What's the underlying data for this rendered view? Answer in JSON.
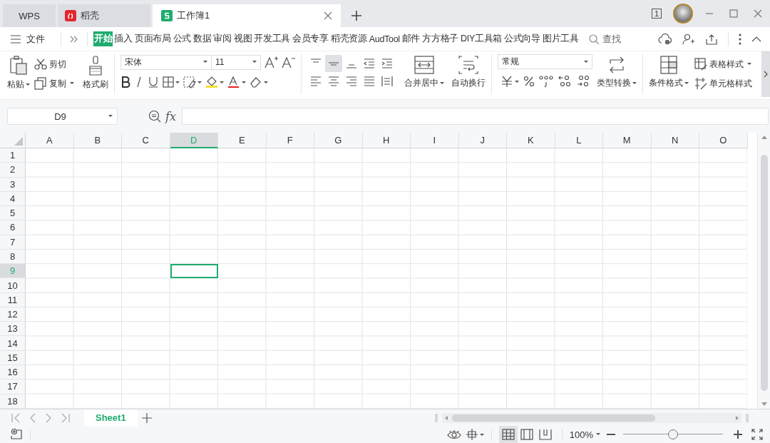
{
  "title_bar": {
    "tabs": [
      {
        "label": "WPS",
        "kind": "home",
        "selected": false
      },
      {
        "label": "稻壳",
        "kind": "docer",
        "selected": false
      },
      {
        "label": "工作簿1",
        "kind": "sheet",
        "selected": true
      }
    ],
    "window_count": "1"
  },
  "menu_bar": {
    "file": "文件",
    "tabs": [
      {
        "label": "开始",
        "selected": true
      },
      {
        "label": "插入",
        "selected": false
      },
      {
        "label": "页面布局",
        "selected": false
      },
      {
        "label": "公式",
        "selected": false
      },
      {
        "label": "数据",
        "selected": false
      },
      {
        "label": "审阅",
        "selected": false
      },
      {
        "label": "视图",
        "selected": false
      },
      {
        "label": "开发工具",
        "selected": false
      },
      {
        "label": "会员专享",
        "selected": false
      },
      {
        "label": "稻壳资源",
        "selected": false
      },
      {
        "label": "AudTool",
        "selected": false
      },
      {
        "label": "邮件",
        "selected": false
      },
      {
        "label": "方方格子",
        "selected": false
      },
      {
        "label": "DIY工具箱",
        "selected": false
      },
      {
        "label": "公式向导",
        "selected": false
      },
      {
        "label": "图片工具",
        "selected": false
      }
    ],
    "search": "查找"
  },
  "ribbon": {
    "paste": "粘贴",
    "cut": "剪切",
    "copy": "复制",
    "format_painter": "格式刷",
    "font_name": "宋体",
    "font_size": "11",
    "alignment": [
      {
        "kind": "top",
        "selected": false
      },
      {
        "kind": "middle",
        "selected": true
      },
      {
        "kind": "bottom",
        "selected": false
      },
      {
        "kind": "outdent",
        "selected": false
      },
      {
        "kind": "indent",
        "selected": false
      },
      {
        "kind": "left",
        "selected": false
      },
      {
        "kind": "center",
        "selected": false
      },
      {
        "kind": "right",
        "selected": false
      },
      {
        "kind": "justify",
        "selected": false
      },
      {
        "kind": "distributed",
        "selected": false
      }
    ],
    "merge": "合并居中",
    "wrap": "自动换行",
    "number_format": "常规",
    "convert": "类型转换",
    "conditional": "条件格式",
    "table_style": "表格样式",
    "cell_style": "单元格样式"
  },
  "formula_bar": {
    "name_box": "D9",
    "fx": "fx"
  },
  "grid": {
    "columns": [
      {
        "label": "A",
        "selected": false
      },
      {
        "label": "B",
        "selected": false
      },
      {
        "label": "C",
        "selected": false
      },
      {
        "label": "D",
        "selected": true
      },
      {
        "label": "E",
        "selected": false
      },
      {
        "label": "F",
        "selected": false
      },
      {
        "label": "G",
        "selected": false
      },
      {
        "label": "H",
        "selected": false
      },
      {
        "label": "I",
        "selected": false
      },
      {
        "label": "J",
        "selected": false
      },
      {
        "label": "K",
        "selected": false
      },
      {
        "label": "L",
        "selected": false
      },
      {
        "label": "M",
        "selected": false
      },
      {
        "label": "N",
        "selected": false
      },
      {
        "label": "O",
        "selected": false
      }
    ],
    "rows": [
      {
        "label": "1",
        "selected": false
      },
      {
        "label": "2",
        "selected": false
      },
      {
        "label": "3",
        "selected": false
      },
      {
        "label": "4",
        "selected": false
      },
      {
        "label": "5",
        "selected": false
      },
      {
        "label": "6",
        "selected": false
      },
      {
        "label": "7",
        "selected": false
      },
      {
        "label": "8",
        "selected": false
      },
      {
        "label": "9",
        "selected": true
      },
      {
        "label": "10",
        "selected": false
      },
      {
        "label": "11",
        "selected": false
      },
      {
        "label": "12",
        "selected": false
      },
      {
        "label": "13",
        "selected": false
      },
      {
        "label": "14",
        "selected": false
      },
      {
        "label": "15",
        "selected": false
      },
      {
        "label": "16",
        "selected": false
      },
      {
        "label": "17",
        "selected": false
      },
      {
        "label": "18",
        "selected": false
      }
    ]
  },
  "sheet_bar": {
    "sheets": [
      {
        "name": "Sheet1",
        "selected": true
      }
    ]
  },
  "status_bar": {
    "views": [
      {
        "kind": "normal",
        "selected": true
      },
      {
        "kind": "page_layout",
        "selected": false
      },
      {
        "kind": "page_break",
        "selected": false
      }
    ],
    "zoom": "100%",
    "zoom_slider": {
      "level": 0.5
    }
  }
}
